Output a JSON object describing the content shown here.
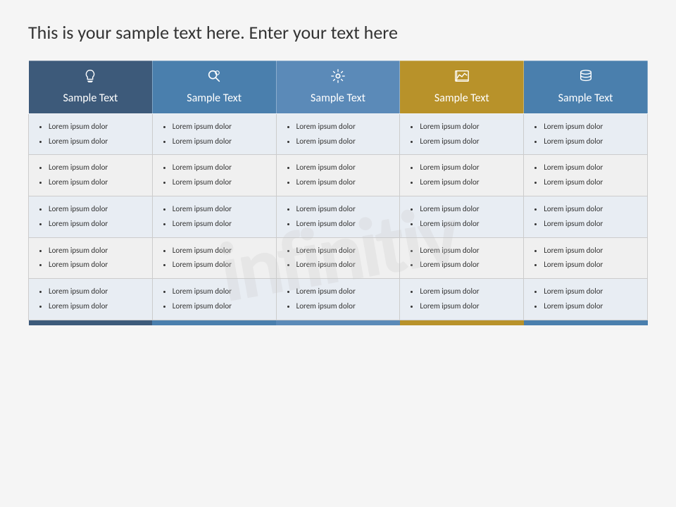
{
  "slide": {
    "title": "This is your sample text here. Enter your text here",
    "watermark": "infinitiv",
    "columns": [
      {
        "id": "col1",
        "icon": "💡",
        "icon_name": "lightbulb-icon",
        "header_label": "Sample Text",
        "header_class": "col1-header",
        "footer_class": "footer-col1"
      },
      {
        "id": "col2",
        "icon": "🔍",
        "icon_name": "search-settings-icon",
        "header_label": "Sample Text",
        "header_class": "col2-header",
        "footer_class": "footer-col2"
      },
      {
        "id": "col3",
        "icon": "⚙",
        "icon_name": "settings-icon",
        "header_label": "Sample Text",
        "header_class": "col3-header",
        "footer_class": "footer-col3"
      },
      {
        "id": "col4",
        "icon": "📉",
        "icon_name": "chart-icon",
        "header_label": "Sample Text",
        "header_class": "col4-header",
        "footer_class": "footer-col4"
      },
      {
        "id": "col5",
        "icon": "🗄",
        "icon_name": "database-icon",
        "header_label": "Sample Text",
        "header_class": "col5-header",
        "footer_class": "footer-col5"
      }
    ],
    "rows": [
      {
        "row_class": "row-even",
        "cells": [
          [
            "Lorem ipsum dolor",
            "Lorem ipsum dolor"
          ],
          [
            "Lorem ipsum dolor",
            "Lorem ipsum dolor"
          ],
          [
            "Lorem ipsum dolor",
            "Lorem ipsum dolor"
          ],
          [
            "Lorem ipsum dolor",
            "Lorem ipsum dolor"
          ],
          [
            "Lorem ipsum dolor",
            "Lorem ipsum dolor"
          ]
        ]
      },
      {
        "row_class": "row-odd",
        "cells": [
          [
            "Lorem ipsum dolor",
            "Lorem ipsum dolor"
          ],
          [
            "Lorem ipsum dolor",
            "Lorem ipsum dolor"
          ],
          [
            "Lorem ipsum dolor",
            "Lorem ipsum dolor"
          ],
          [
            "Lorem ipsum dolor",
            "Lorem ipsum dolor"
          ],
          [
            "Lorem ipsum dolor",
            "Lorem ipsum dolor"
          ]
        ]
      },
      {
        "row_class": "row-even",
        "cells": [
          [
            "Lorem ipsum dolor",
            "Lorem ipsum dolor"
          ],
          [
            "Lorem ipsum dolor",
            "Lorem ipsum dolor"
          ],
          [
            "Lorem ipsum dolor",
            "Lorem ipsum dolor"
          ],
          [
            "Lorem ipsum dolor",
            "Lorem ipsum dolor"
          ],
          [
            "Lorem ipsum dolor",
            "Lorem ipsum dolor"
          ]
        ]
      },
      {
        "row_class": "row-odd",
        "cells": [
          [
            "Lorem ipsum dolor",
            "Lorem ipsum dolor"
          ],
          [
            "Lorem ipsum dolor",
            "Lorem ipsum dolor"
          ],
          [
            "Lorem ipsum dolor",
            "Lorem ipsum dolor"
          ],
          [
            "Lorem ipsum dolor",
            "Lorem ipsum dolor"
          ],
          [
            "Lorem ipsum dolor",
            "Lorem ipsum dolor"
          ]
        ]
      },
      {
        "row_class": "row-even",
        "cells": [
          [
            "Lorem ipsum dolor",
            "Lorem ipsum dolor"
          ],
          [
            "Lorem ipsum dolor",
            "Lorem ipsum dolor"
          ],
          [
            "Lorem ipsum dolor",
            "Lorem ipsum dolor"
          ],
          [
            "Lorem ipsum dolor",
            "Lorem ipsum dolor"
          ],
          [
            "Lorem ipsum dolor",
            "Lorem ipsum dolor"
          ]
        ]
      }
    ]
  }
}
